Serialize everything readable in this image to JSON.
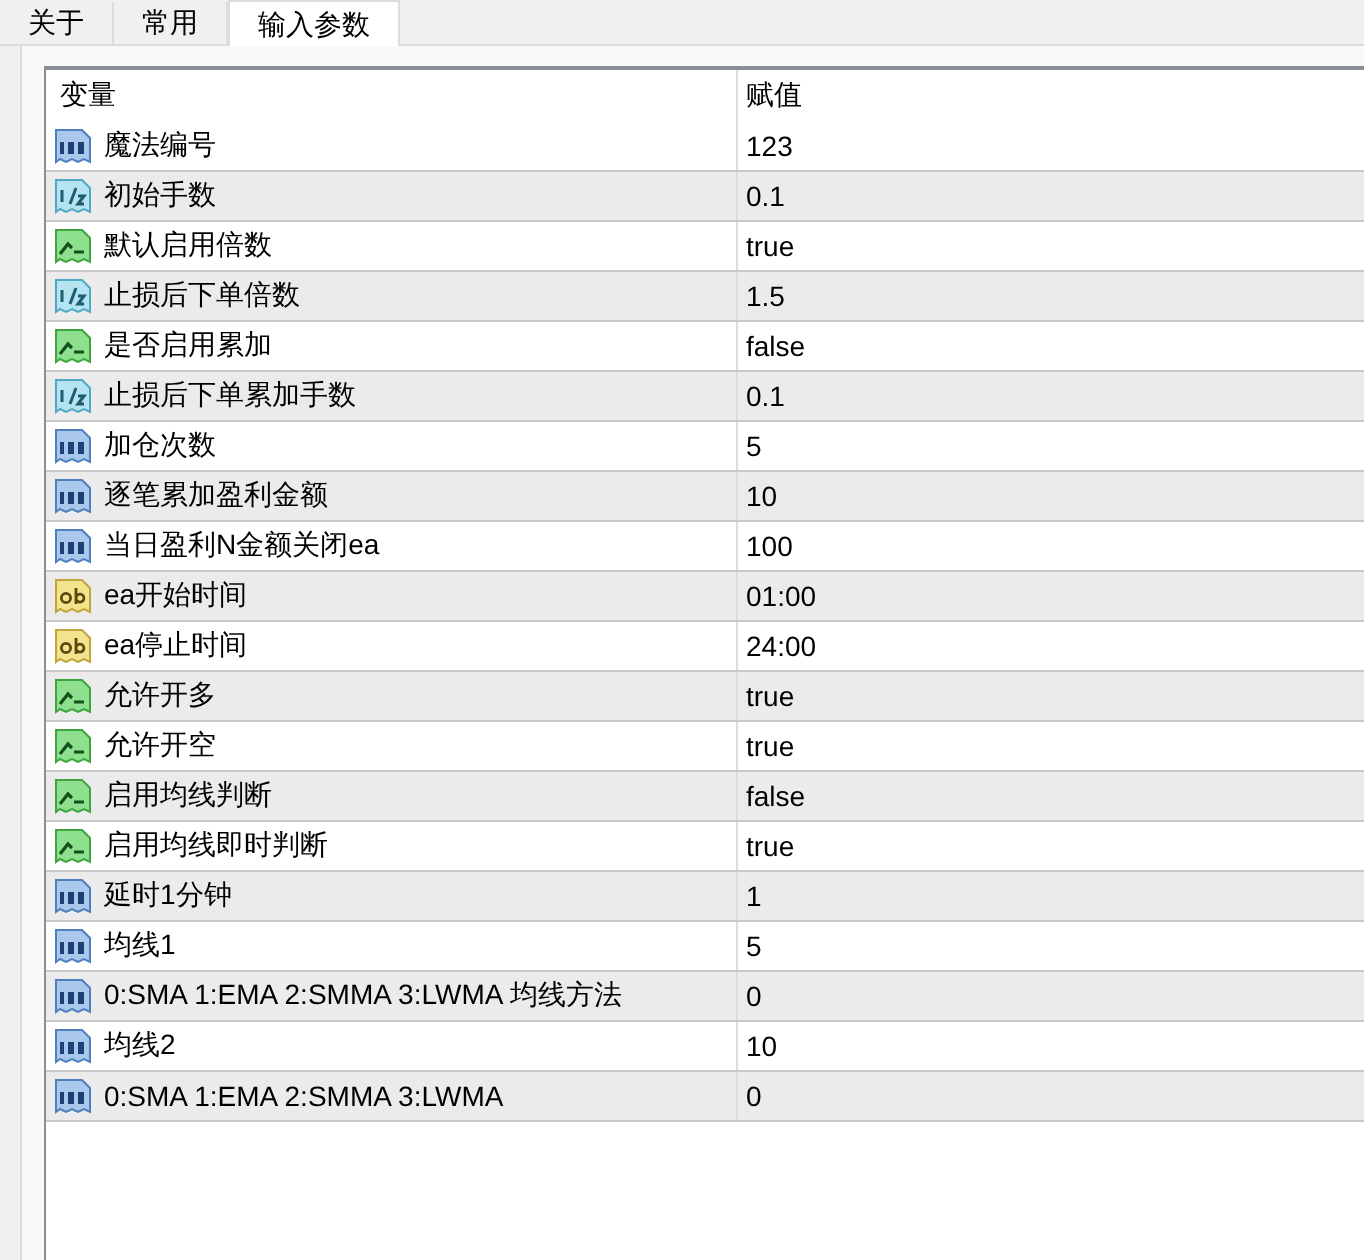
{
  "tabs": [
    {
      "label": "关于",
      "selected": false
    },
    {
      "label": "常用",
      "selected": false
    },
    {
      "label": "输入参数",
      "selected": true
    }
  ],
  "table": {
    "columns": [
      "变量",
      "赋值"
    ],
    "rows": [
      {
        "kind": "int",
        "name": "魔法编号",
        "value": "123"
      },
      {
        "kind": "double",
        "name": "初始手数",
        "value": "0.1"
      },
      {
        "kind": "bool",
        "name": "默认启用倍数",
        "value": "true"
      },
      {
        "kind": "double",
        "name": "止损后下单倍数",
        "value": "1.5"
      },
      {
        "kind": "bool",
        "name": "是否启用累加",
        "value": "false"
      },
      {
        "kind": "double",
        "name": "止损后下单累加手数",
        "value": "0.1"
      },
      {
        "kind": "int",
        "name": "加仓次数",
        "value": "5"
      },
      {
        "kind": "int",
        "name": "逐笔累加盈利金额",
        "value": "10"
      },
      {
        "kind": "int",
        "name": "当日盈利N金额关闭ea",
        "value": "100"
      },
      {
        "kind": "string",
        "name": "ea开始时间",
        "value": "01:00"
      },
      {
        "kind": "string",
        "name": "ea停止时间",
        "value": "24:00"
      },
      {
        "kind": "bool",
        "name": "允许开多",
        "value": "true"
      },
      {
        "kind": "bool",
        "name": "允许开空",
        "value": "true"
      },
      {
        "kind": "bool",
        "name": "启用均线判断",
        "value": "false"
      },
      {
        "kind": "bool",
        "name": "启用均线即时判断",
        "value": "true"
      },
      {
        "kind": "int",
        "name": "延时1分钟",
        "value": "1"
      },
      {
        "kind": "int",
        "name": "均线1",
        "value": "5"
      },
      {
        "kind": "int",
        "name": "0:SMA 1:EMA 2:SMMA 3:LWMA 均线方法",
        "value": "0"
      },
      {
        "kind": "int",
        "name": "均线2",
        "value": "10"
      },
      {
        "kind": "int",
        "name": "0:SMA 1:EMA 2:SMMA 3:LWMA",
        "value": "0"
      }
    ]
  }
}
